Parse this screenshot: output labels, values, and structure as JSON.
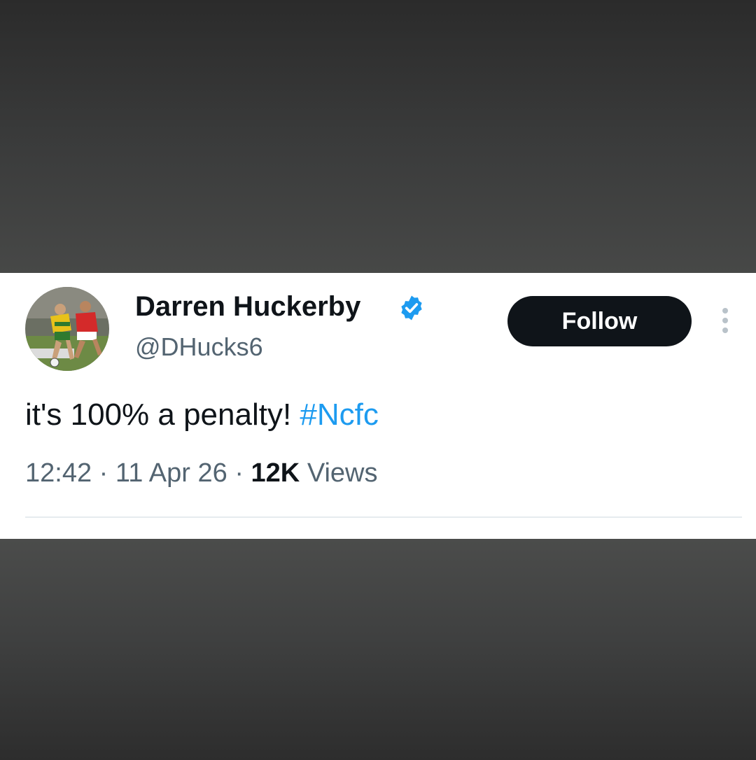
{
  "tweet": {
    "author": {
      "display_name": "Darren Huckerby",
      "handle": "@DHucks6",
      "verified_icon": "verified-badge-icon",
      "avatar_icon": "profile-photo"
    },
    "follow_label": "Follow",
    "more_icon": "more-options-icon",
    "text": "it's 100% a penalty!",
    "hashtag": "#Ncfc",
    "time": "12:42",
    "date": "11 Apr 26",
    "separator": "·",
    "views_count": "12K",
    "views_label": "Views"
  },
  "colors": {
    "background": "#3a3a3a",
    "card": "#ffffff",
    "text_primary": "#0f1419",
    "text_secondary": "#536471",
    "accent": "#1d9bf0",
    "follow_button": "#0f1419"
  }
}
